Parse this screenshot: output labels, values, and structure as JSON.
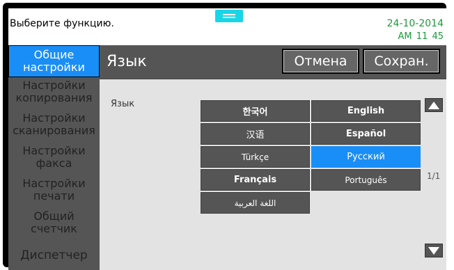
{
  "header": {
    "prompt": "Выберите функцию.",
    "date": "24-10-2014",
    "time": "AM 11  45"
  },
  "sidebar": {
    "items": [
      {
        "lines": [
          "Общие",
          "настройки"
        ],
        "active": true
      },
      {
        "lines": [
          "Настройки",
          "копирования"
        ],
        "active": false
      },
      {
        "lines": [
          "Настройки",
          "сканирования"
        ],
        "active": false
      },
      {
        "lines": [
          "Настройки",
          "факса"
        ],
        "active": false
      },
      {
        "lines": [
          "Настройки",
          "печати"
        ],
        "active": false
      },
      {
        "lines": [
          "Общий",
          "счетчик"
        ],
        "active": false
      },
      {
        "lines": [
          "Диспетчер"
        ],
        "active": false
      }
    ]
  },
  "main": {
    "title": "Язык",
    "cancel_label": "Отмена",
    "save_label": "Сохран.",
    "field_label": "Язык",
    "page_indicator": "1/1",
    "languages": [
      {
        "label": "한국어",
        "selected": false
      },
      {
        "label": "English",
        "selected": false
      },
      {
        "label": "汉语",
        "selected": false
      },
      {
        "label": "Español",
        "selected": false
      },
      {
        "label": "Türkçe",
        "selected": false
      },
      {
        "label": "Русский",
        "selected": true
      },
      {
        "label": "Français",
        "selected": false
      },
      {
        "label": "Português",
        "selected": false
      },
      {
        "label": "اللغة العربية",
        "selected": false
      }
    ]
  },
  "colors": {
    "accent": "#1a8ef7",
    "time_text": "#1a9a3a",
    "handle": "#19d6e6",
    "button_bg": "#555555"
  },
  "icons": {
    "scroll_up": "triangle-up-icon",
    "scroll_down": "triangle-down-icon",
    "handle": "menu-handle-icon"
  }
}
